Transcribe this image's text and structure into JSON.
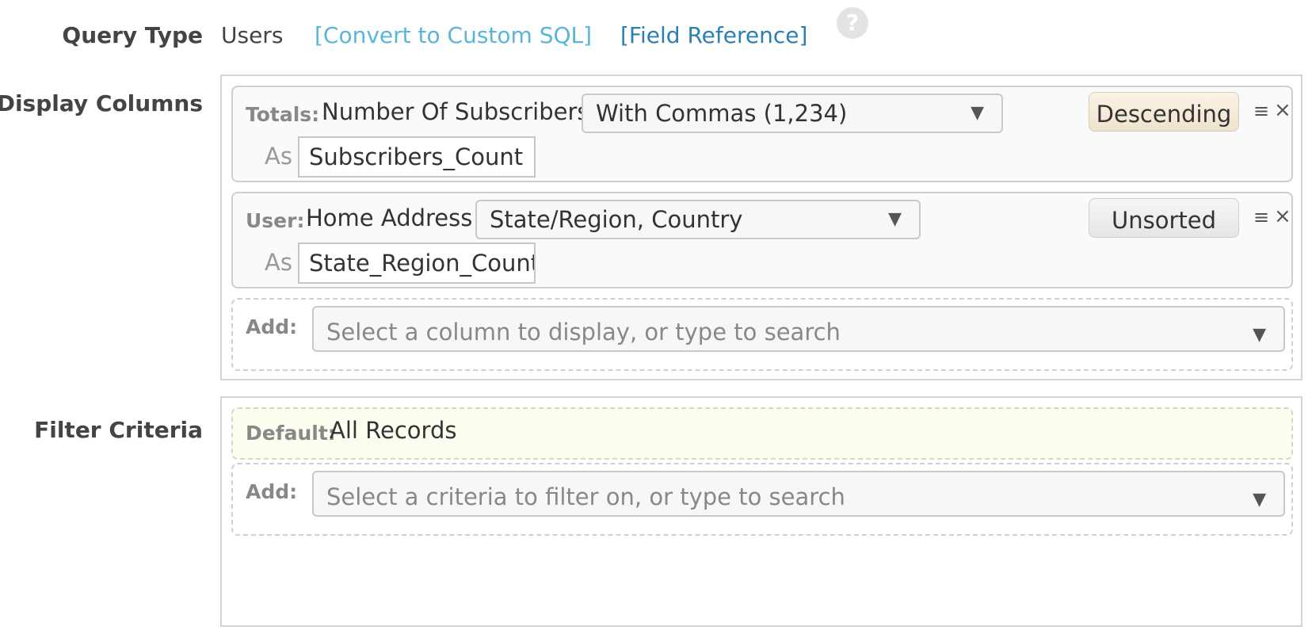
{
  "query_type": {
    "label": "Query Type",
    "value": "Users",
    "convert_link": "[Convert to Custom SQL]",
    "field_reference_link": "[Field Reference]",
    "help_icon": "?"
  },
  "display_columns": {
    "label": "Display Columns",
    "columns": [
      {
        "key": "Totals:",
        "field": "Number Of Subscribers",
        "format": "With Commas (1,234)",
        "as_label": "As",
        "alias": "Subscribers_Count",
        "sort": "Descending"
      },
      {
        "key": "User:",
        "field": "Home Address",
        "format": "State/Region, Country",
        "as_label": "As",
        "alias": "State_Region_Country",
        "sort": "Unsorted"
      }
    ],
    "add_label": "Add:",
    "add_placeholder": "Select a column to display, or type to search"
  },
  "filter_criteria": {
    "label": "Filter Criteria",
    "default_key": "Default:",
    "default_value": "All Records",
    "add_label": "Add:",
    "add_placeholder": "Select a criteria to filter on, or type to search"
  },
  "icons": {
    "caret": "▼",
    "handle": "≡",
    "close": "×"
  },
  "colors": {
    "link_light": "#5ab6d9",
    "link_dark": "#2c7fb3",
    "descending_button": "#f4e9d6",
    "default_filter_bg": "#fdfdf0"
  }
}
